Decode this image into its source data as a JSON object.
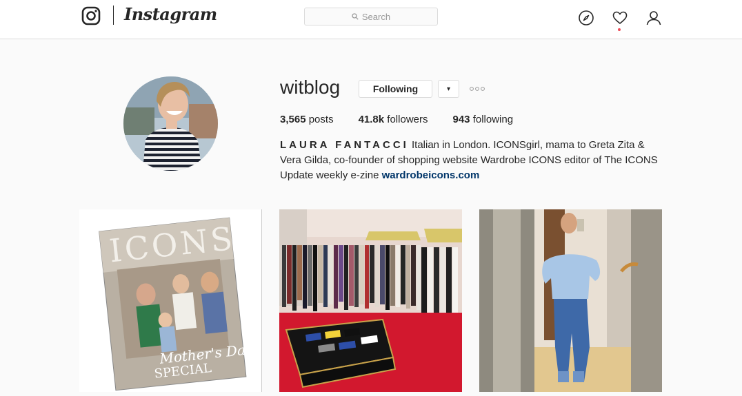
{
  "header": {
    "wordmark": "Instagram",
    "search_placeholder": "Search",
    "icons": [
      "instagram-logo-icon",
      "search-icon",
      "compass-icon",
      "heart-icon",
      "profile-icon"
    ],
    "notification_color": "#ed4956"
  },
  "profile": {
    "username": "witblog",
    "follow_label": "Following",
    "dropdown_glyph": "▾",
    "stats": {
      "posts_count": "3,565",
      "posts_label": "posts",
      "followers_count": "41.8k",
      "followers_label": "followers",
      "following_count": "943",
      "following_label": "following"
    },
    "bio": {
      "name": "LAURA FANTACCI",
      "text": " Italian in London. ICONSgirl, mama to Greta Zita & Vera Gilda, co-founder of shopping website Wardrobe ICONS editor of The ICONS Update weekly e-zine ",
      "link": "wardrobeicons.com"
    }
  },
  "posts": [
    {
      "description": "ICONS magazine cover, Mother's Day Special"
    },
    {
      "description": "clothing store interior with red carpet"
    },
    {
      "description": "mirror selfie in blue off-shoulder top and jeans"
    }
  ],
  "cover_text": {
    "title": "ICONS",
    "headline": "Mother's Day",
    "subhead": "SPECIAL"
  },
  "colors": {
    "link": "#003569",
    "border": "#dbdbdb",
    "background": "#fafafa"
  }
}
